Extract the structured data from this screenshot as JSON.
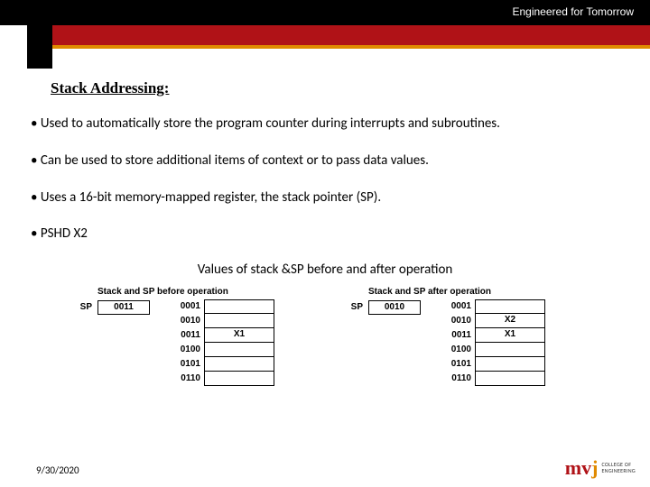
{
  "header": {
    "tagline": "Engineered for Tomorrow"
  },
  "title": "Stack Addressing:",
  "bullets": [
    "• Used to automatically store the program counter during interrupts and subroutines.",
    "• Can be used to store additional items of context or to pass data values.",
    "• Uses a 16-bit memory-mapped register, the stack pointer (SP).",
    "• PSHD X2"
  ],
  "caption": "Values of stack &SP before and after operation",
  "diagram": {
    "before": {
      "title": "Stack and SP before operation",
      "sp_label": "SP",
      "sp_value": "0011",
      "mem": [
        {
          "addr": "0001",
          "val": ""
        },
        {
          "addr": "0010",
          "val": ""
        },
        {
          "addr": "0011",
          "val": "X1"
        },
        {
          "addr": "0100",
          "val": ""
        },
        {
          "addr": "0101",
          "val": ""
        },
        {
          "addr": "0110",
          "val": ""
        }
      ]
    },
    "after": {
      "title": "Stack and SP after operation",
      "sp_label": "SP",
      "sp_value": "0010",
      "mem": [
        {
          "addr": "0001",
          "val": ""
        },
        {
          "addr": "0010",
          "val": "X2"
        },
        {
          "addr": "0011",
          "val": "X1"
        },
        {
          "addr": "0100",
          "val": ""
        },
        {
          "addr": "0101",
          "val": ""
        },
        {
          "addr": "0110",
          "val": ""
        }
      ]
    }
  },
  "footer": {
    "date": "9/30/2020",
    "logo_m": "m",
    "logo_v": "v",
    "logo_j": "j",
    "logo_line1": "COLLEGE OF",
    "logo_line2": "ENGINEERING"
  }
}
